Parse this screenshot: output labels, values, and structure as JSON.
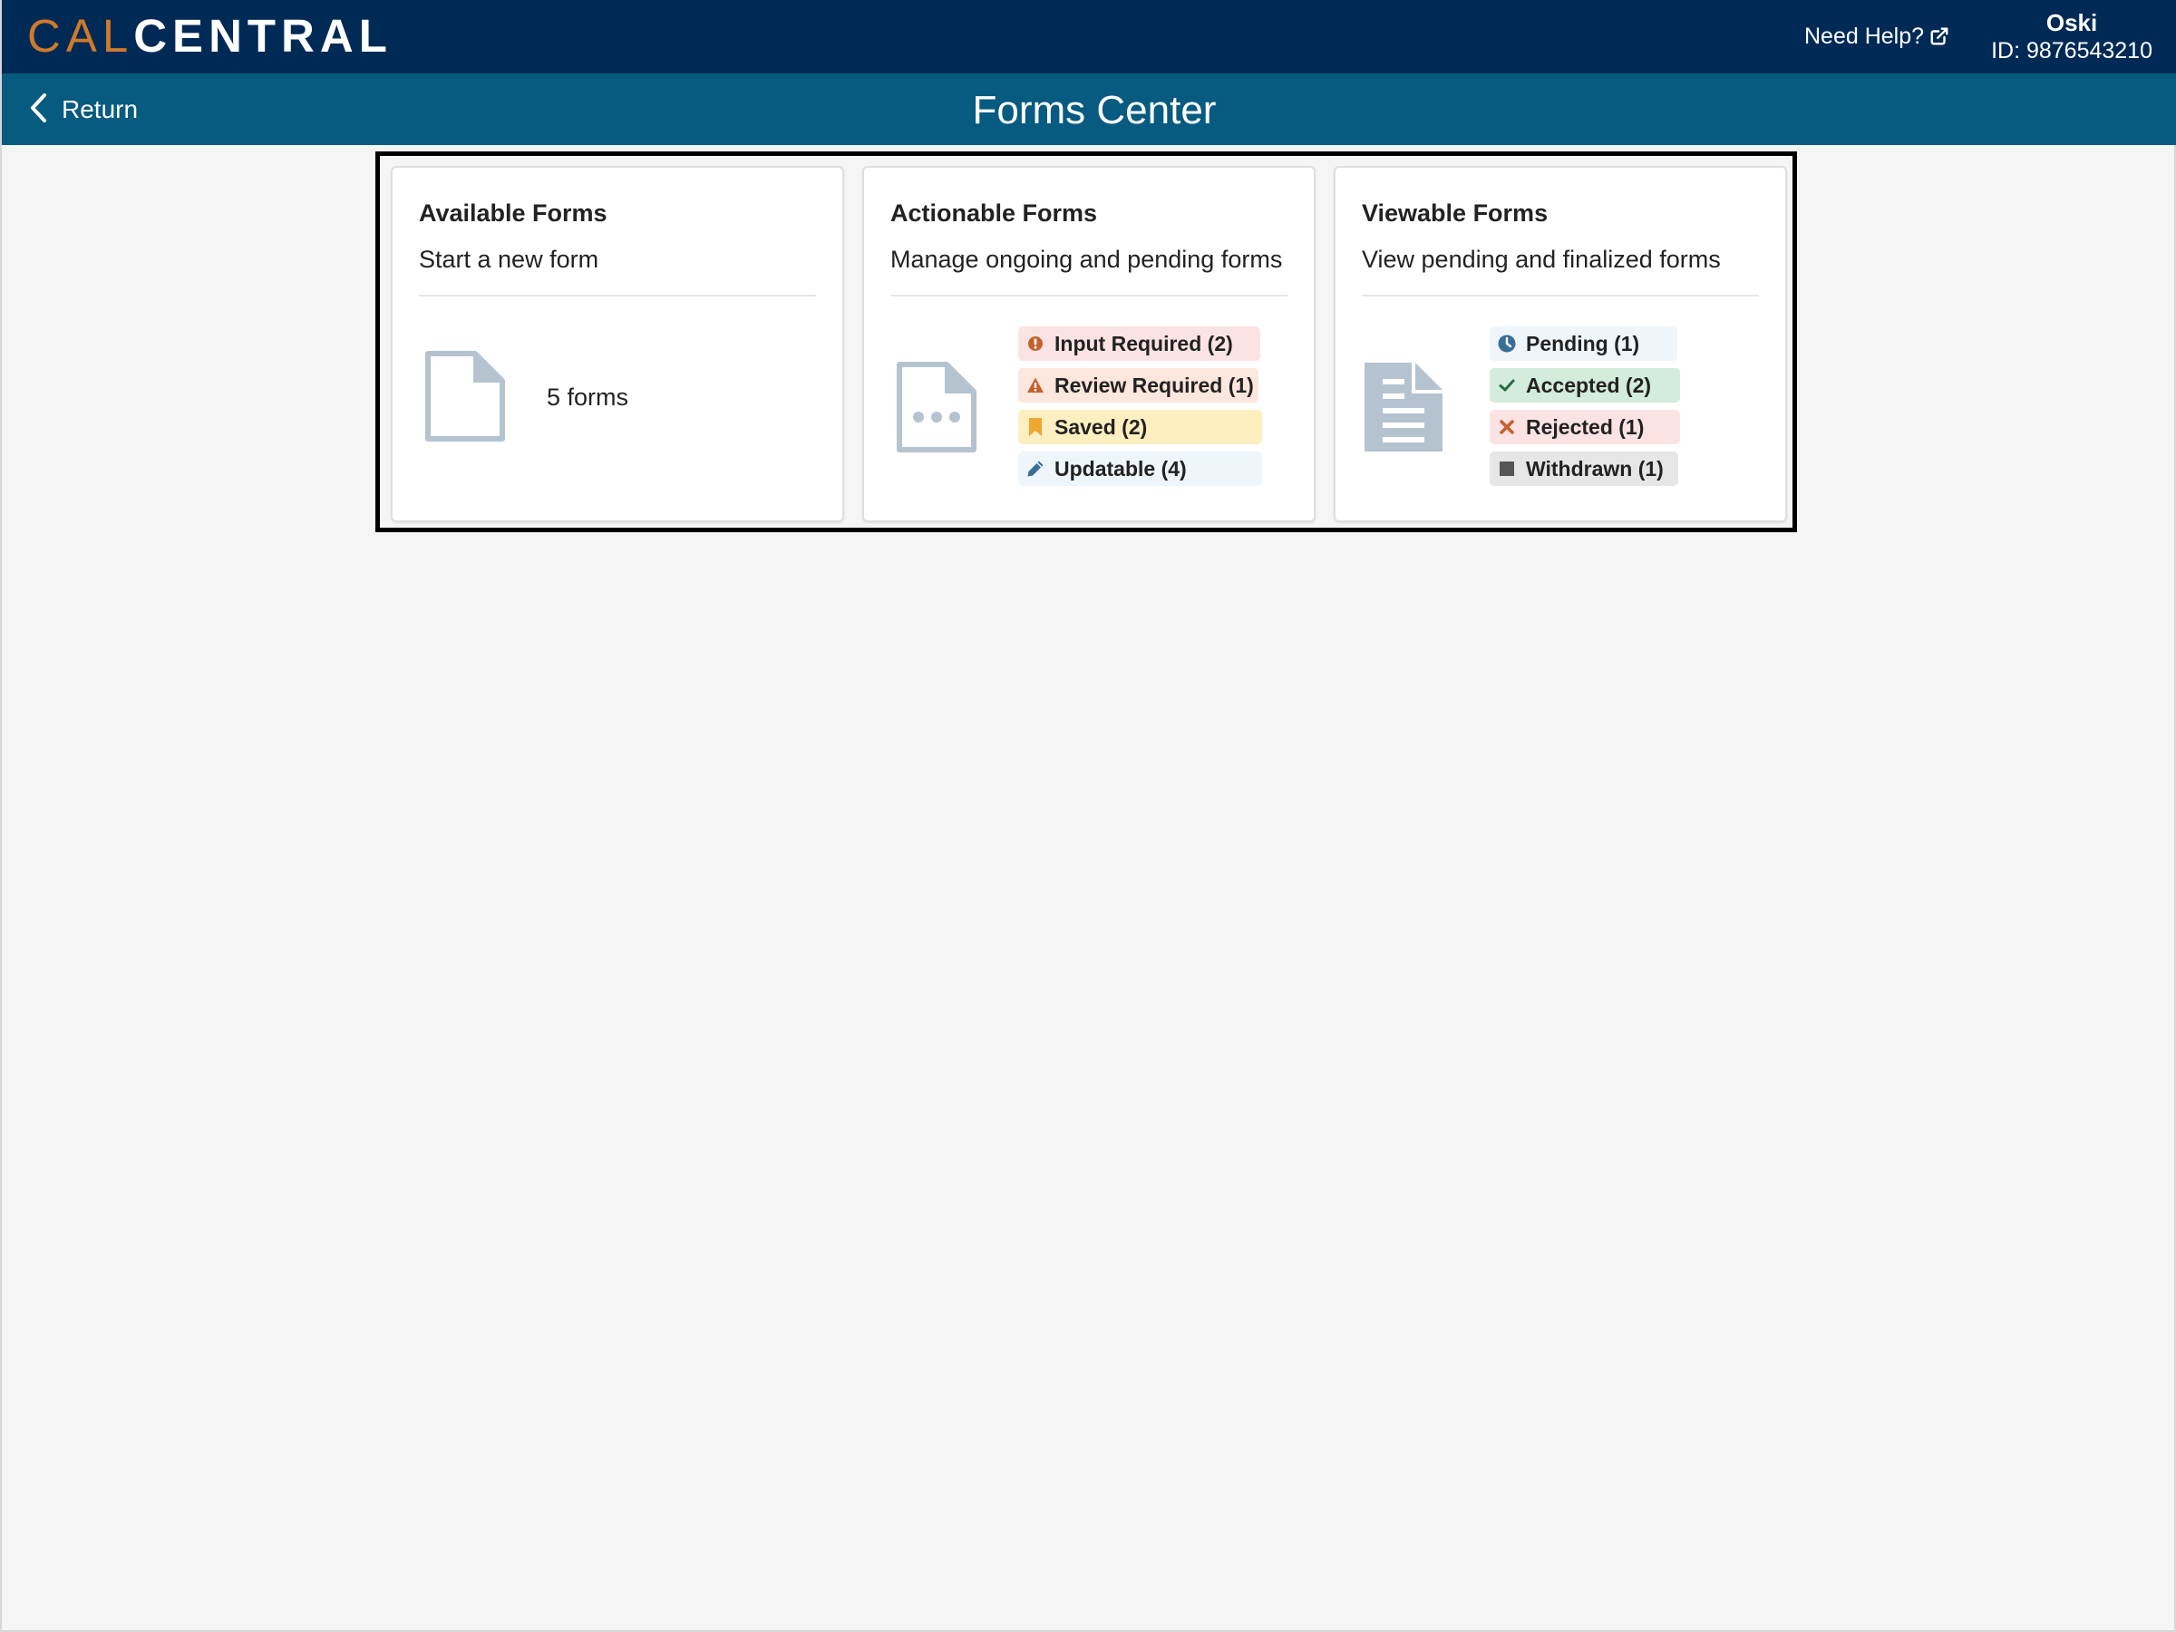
{
  "header": {
    "logo_part1": "CAL",
    "logo_part2": "CENTRAL",
    "help_label": "Need Help?",
    "user_name": "Oski",
    "user_id": "ID: 9876543210"
  },
  "subheader": {
    "return_label": "Return",
    "title": "Forms Center"
  },
  "cards": {
    "available": {
      "title": "Available Forms",
      "subtitle": "Start a new form",
      "count_label": "5 forms",
      "icon": "file-outline-icon"
    },
    "actionable": {
      "title": "Actionable Forms",
      "subtitle": "Manage ongoing and pending forms",
      "icon": "file-ellipsis-icon",
      "badges": [
        {
          "label": "Input Required (2)",
          "icon": "exclamation-circle-icon",
          "bg": "#fce3e3",
          "icon_color": "#c4622d"
        },
        {
          "label": "Review Required (1)",
          "icon": "warning-triangle-icon",
          "bg": "#fde6dd",
          "icon_color": "#c4622d"
        },
        {
          "label": "Saved (2)",
          "icon": "bookmark-icon",
          "bg": "#fdefbf",
          "icon_color": "#f0a732"
        },
        {
          "label": "Updatable (4)",
          "icon": "pencil-icon",
          "bg": "#eef5fb",
          "icon_color": "#3a6e95"
        }
      ]
    },
    "viewable": {
      "title": "Viewable Forms",
      "subtitle": "View pending and finalized forms",
      "icon": "file-text-icon",
      "badges": [
        {
          "label": "Pending (1)",
          "icon": "clock-icon",
          "bg": "#eef5fb",
          "icon_color": "#3a6e95"
        },
        {
          "label": "Accepted (2)",
          "icon": "check-icon",
          "bg": "#d3ecdb",
          "icon_color": "#2b6b43"
        },
        {
          "label": "Rejected (1)",
          "icon": "x-icon",
          "bg": "#fce3e3",
          "icon_color": "#c4622d"
        },
        {
          "label": "Withdrawn (1)",
          "icon": "square-icon",
          "bg": "#e6e6e6",
          "icon_color": "#555555"
        }
      ]
    }
  }
}
